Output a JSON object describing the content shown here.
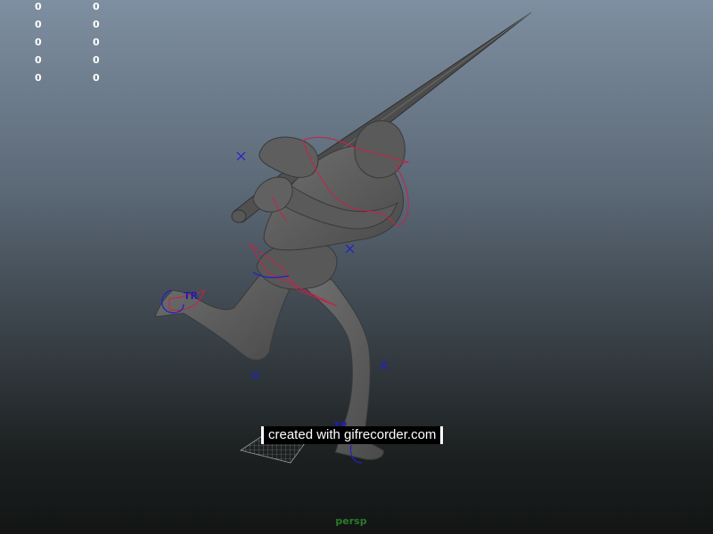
{
  "hud": {
    "left_values": [
      "0",
      "0",
      "0",
      "0",
      "0"
    ],
    "right_values": [
      "0",
      "0",
      "0",
      "0",
      "0"
    ]
  },
  "viewport": {
    "camera": "persp",
    "watermark": "created with gifrecorder.com",
    "handle_labels": [
      "TR",
      "TR"
    ]
  },
  "colors": {
    "mesh": "#5d5d5d",
    "mesh_shade": "#3c3c3c",
    "curve_red": "#c8204a",
    "curve_blue": "#2020c8"
  }
}
